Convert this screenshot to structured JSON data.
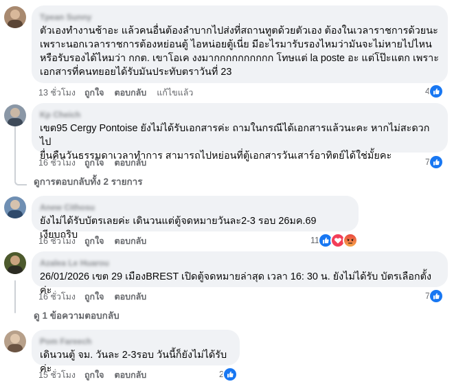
{
  "colors": {
    "bubble_bg": "#f0f2f5",
    "meta_text": "#65676b",
    "like_blue": "#1877f2",
    "love_red": "#f33e58",
    "angry_orange": "#f7714b"
  },
  "comments": [
    {
      "author": "Tpean Sunny",
      "text": "ตัวเองทำงานช้าอะ แล้วคนอื่นต้องลำบากไปส่งที่สถานทูตด้วยตัวเอง ต้องในเวลาราชการด้วยนะ\nเพราะนอกเวลาราชการต้องหย่อนตู้ ไอหน่อยตู้เนี่ย มีอะไรมารับรองไหมว่ามันจะไม่หายไปไหน\nหรือรับรองได้ไหมว่า กกต. เขาโอเค งงมากกกกกกกกกก โทษแต่ la poste อะ แต่โป๊ะแตก เพราะ\nเอกสารที่คนทยอยได้รับมันประทับตราวันที่ 23",
      "time": "13 ชั่วโมง",
      "like": "ถูกใจ",
      "reply": "ตอบกลับ",
      "edited": "แก้ไขแล้ว",
      "reaction_count": "4",
      "reactions": [
        "like-icon"
      ]
    },
    {
      "author": "Kp Cheich",
      "text": "เขต95 Cergy Pontoise ยังไม่ได้รับเอกสารค่ะ ถามในกรณีได้เอกสารแล้วนะคะ หากไม่สะดวกไป\nยื่นคืนวันธรรมดาเวลาทำการ สามารถไปหย่อนที่ตู้เอกสารวันเสาร์อาทิตย์ได้ใช่มั้ยคะ",
      "time": "16 ชั่วโมง",
      "like": "ถูกใจ",
      "reply": "ตอบกลับ",
      "reaction_count": "7",
      "reactions": [
        "like-icon"
      ],
      "view_replies": "ดูการตอบกลับทั้ง 2 รายการ"
    },
    {
      "author": "Anew Cithosu",
      "text": "ยังไม่ได้รับบัตรเลยค่ะ เดินวนแต่ตู้จดหมายวันละ2-3 รอบ 26มค.69 เงียบกริบ",
      "time": "16 ชั่วโมง",
      "like": "ถูกใจ",
      "reply": "ตอบกลับ",
      "reaction_count": "11",
      "reactions": [
        "like-icon",
        "love-icon",
        "angry-icon"
      ]
    },
    {
      "author": "Azalea Le Huarou",
      "text": "26/01/2026 เขต 29 เมืองBREST เปิดตู้จดหมายล่าสุด เวลา 16: 30 น. ยังไม่ได้รับ บัตรเลือกตั้งค่ะ",
      "time": "16 ชั่วโมง",
      "like": "ถูกใจ",
      "reply": "ตอบกลับ",
      "reaction_count": "7",
      "reactions": [
        "like-icon"
      ],
      "view_replies": "ดู 1 ข้อความตอบกลับ"
    },
    {
      "author": "Pom Fareech",
      "text": "เดินวนตู้ จม. วันละ 2-3รอบ วันนี้ก็ยังไม่ได้รับค่ะ",
      "time": "15 ชั่วโมง",
      "like": "ถูกใจ",
      "reply": "ตอบกลับ",
      "reaction_count": "2",
      "reactions": [
        "like-icon"
      ]
    }
  ]
}
